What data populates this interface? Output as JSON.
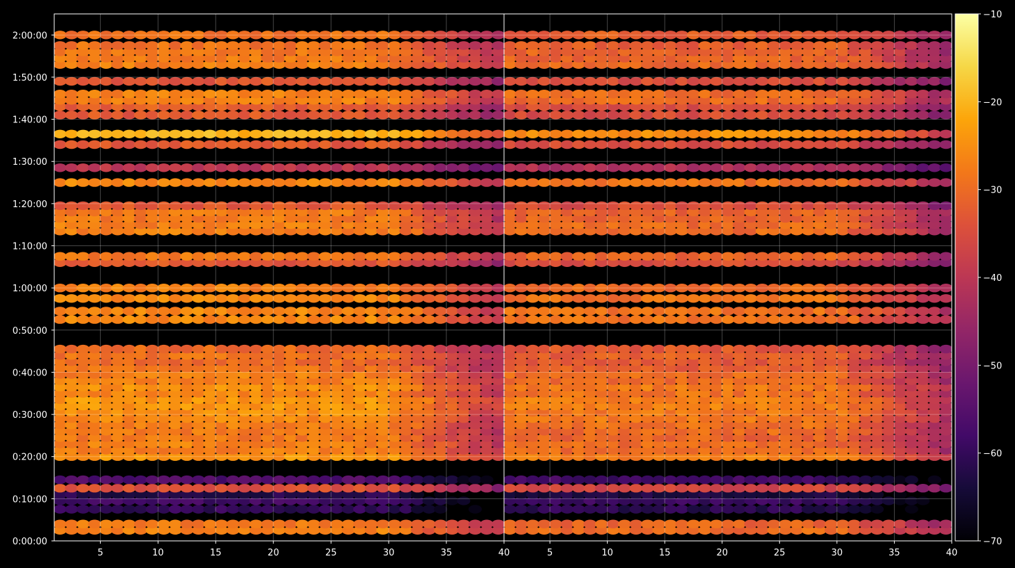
{
  "chart_data": {
    "type": "heatmap",
    "panels": [
      {
        "name": "",
        "x_ticks": [
          5,
          10,
          15,
          20,
          25,
          30,
          35,
          40
        ],
        "xlim": [
          1,
          40
        ],
        "rows_time": [
          "0:02:30",
          "0:04:00",
          "0:07:30",
          "0:09:30",
          "0:11:00",
          "0:12:30",
          "0:14:30",
          "0:20:00",
          "0:21:30",
          "0:23:00",
          "0:24:30",
          "0:26:00",
          "0:27:30",
          "0:29:00",
          "0:30:30",
          "0:32:00",
          "0:33:30",
          "0:35:00",
          "0:36:30",
          "0:38:00",
          "0:39:30",
          "0:41:00",
          "0:42:30",
          "0:44:00",
          "0:45:30",
          "0:52:30",
          "0:54:30",
          "0:57:30",
          "1:00:00",
          "1:06:00",
          "1:07:30",
          "1:13:30",
          "1:15:00",
          "1:16:30",
          "1:18:00",
          "1:19:30",
          "1:25:00",
          "1:28:30",
          "1:34:00",
          "1:36:30",
          "1:41:00",
          "1:43:00",
          "1:44:30",
          "1:46:00",
          "1:49:00",
          "1:53:00",
          "1:54:30",
          "1:56:00",
          "1:57:30",
          "2:00:00"
        ],
        "row_levels_db": [
          -27,
          -28,
          -60,
          -58,
          -62,
          -34,
          -56,
          -24,
          -27,
          -27,
          -28,
          -28,
          -27,
          -26,
          -25,
          -24,
          -24,
          -26,
          -25,
          -27,
          -27,
          -29,
          -30,
          -29,
          -30,
          -26,
          -26,
          -26,
          -27,
          -33,
          -28,
          -27,
          -27,
          -28,
          -28,
          -33,
          -26,
          -40,
          -33,
          -20,
          -33,
          -32,
          -27,
          -27,
          -33,
          -27,
          -28,
          -28,
          -29,
          -29
        ],
        "fade_db_per_bin_after_30": -1.4
      },
      {
        "name": "",
        "x_ticks": [
          5,
          10,
          15,
          20,
          25,
          30,
          35,
          40
        ],
        "xlim": [
          1,
          40
        ],
        "rows_time": [
          "0:02:30",
          "0:04:00",
          "0:07:30",
          "0:09:30",
          "0:11:00",
          "0:12:30",
          "0:14:30",
          "0:20:00",
          "0:21:30",
          "0:23:00",
          "0:24:30",
          "0:26:00",
          "0:27:30",
          "0:29:00",
          "0:30:30",
          "0:32:00",
          "0:33:30",
          "0:35:00",
          "0:36:30",
          "0:38:00",
          "0:39:30",
          "0:41:00",
          "0:42:30",
          "0:44:00",
          "0:45:30",
          "0:52:30",
          "0:54:30",
          "0:57:30",
          "1:00:00",
          "1:06:00",
          "1:07:30",
          "1:13:30",
          "1:15:00",
          "1:16:30",
          "1:18:00",
          "1:19:30",
          "1:25:00",
          "1:28:30",
          "1:34:00",
          "1:36:30",
          "1:41:00",
          "1:43:00",
          "1:44:30",
          "1:46:00",
          "1:49:00",
          "1:53:00",
          "1:54:30",
          "1:56:00",
          "1:57:30",
          "2:00:00"
        ],
        "row_levels_db": [
          -30,
          -31,
          -61,
          -59,
          -63,
          -36,
          -58,
          -27,
          -30,
          -30,
          -31,
          -30,
          -29,
          -28,
          -28,
          -27,
          -27,
          -29,
          -28,
          -30,
          -30,
          -32,
          -33,
          -32,
          -33,
          -29,
          -29,
          -29,
          -30,
          -35,
          -31,
          -30,
          -30,
          -31,
          -31,
          -35,
          -29,
          -42,
          -35,
          -25,
          -35,
          -35,
          -30,
          -30,
          -35,
          -30,
          -31,
          -31,
          -32,
          -32
        ],
        "fade_db_per_bin_after_30": -1.4
      }
    ],
    "y_ticks": [
      "0:00:00",
      "0:10:00",
      "0:20:00",
      "0:30:00",
      "0:40:00",
      "0:50:00",
      "1:00:00",
      "1:10:00",
      "1:20:00",
      "1:30:00",
      "1:40:00",
      "1:50:00",
      "2:00:00"
    ],
    "ylim_seconds": [
      0,
      7500
    ],
    "colorbar": {
      "ticks": [
        "−10",
        "−20",
        "−30",
        "−40",
        "−50",
        "−60",
        "−70"
      ],
      "range": [
        -70,
        -10
      ],
      "colormap": "inferno"
    },
    "grid": true,
    "background": "#000000",
    "grid_color": "#ffffff"
  }
}
